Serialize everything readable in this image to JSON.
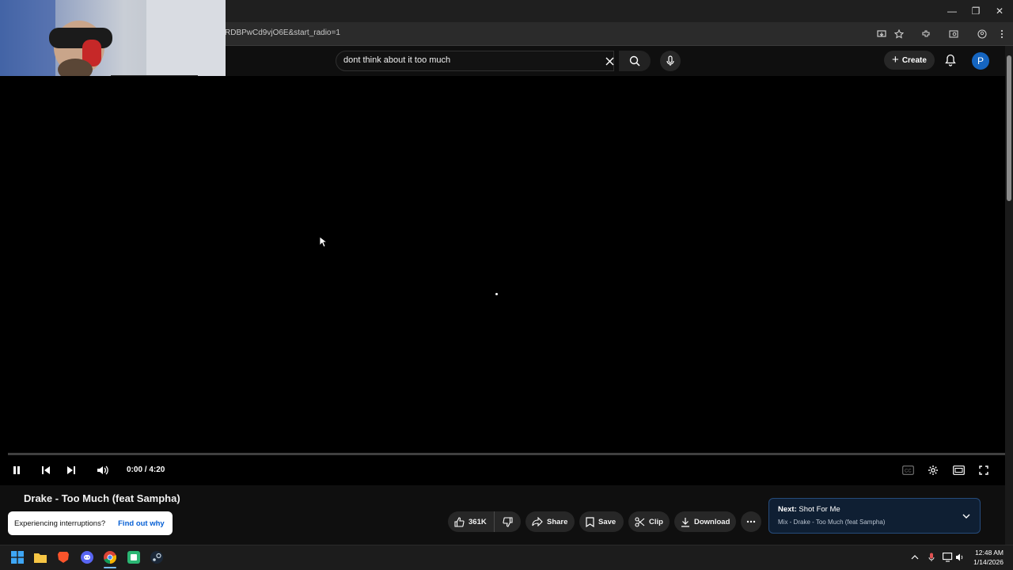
{
  "browser": {
    "url": "RDBPwCd9vjO6E&start_radio=1",
    "window_controls": [
      "minimize",
      "restore",
      "close"
    ]
  },
  "header": {
    "search_value": "dont think about it too much",
    "create_label": "Create",
    "avatar_letter": "P"
  },
  "player": {
    "time": "0:00 / 4:20",
    "progress_fraction": 0
  },
  "video": {
    "title": "Drake - Too Much (feat Sampha)"
  },
  "toast": {
    "message": "Experiencing interruptions?",
    "link": "Find out why"
  },
  "actions": {
    "likes": "361K",
    "share": "Share",
    "save": "Save",
    "clip": "Clip",
    "download": "Download"
  },
  "next": {
    "prefix": "Next:",
    "title": "Shot For Me",
    "subtitle": "Mix - Drake - Too Much (feat Sampha)"
  },
  "taskbar": {
    "time": "12:48 AM",
    "date": "1/14/2026",
    "apps": [
      "windows-start",
      "file-explorer",
      "brave",
      "discord",
      "chrome",
      "app-green",
      "steam"
    ]
  },
  "colors": {
    "accent": "#ff0000",
    "avatar": "#1565c0",
    "link": "#065fd4"
  }
}
